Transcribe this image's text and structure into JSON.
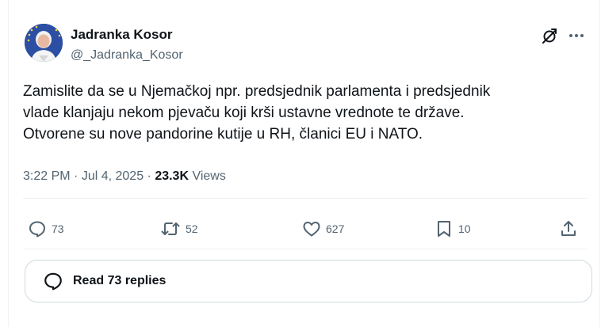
{
  "author": {
    "name": "Jadranka Kosor",
    "handle": "@_Jadranka_Kosor"
  },
  "tweet": {
    "lines": [
      "Zamislite da se u Njemačkoj npr. predsjednik parlamenta i predsjednik",
      "vlade klanjaju nekom pjevaču koji krši ustavne vrednote te države.",
      "Otvorene su nove pandorine kutije u RH, članici EU i NATO."
    ]
  },
  "meta": {
    "time": "3:22 PM",
    "separator1": " · ",
    "date": "Jul 4, 2025",
    "separator2": " · ",
    "views_count": "23.3K",
    "views_label": " Views"
  },
  "actions": {
    "replies": "73",
    "reposts": "52",
    "likes": "627",
    "bookmarks": "10"
  },
  "read_replies": {
    "label": "Read 73 replies"
  },
  "icons": {
    "header": [
      "grok-icon",
      "more-icon"
    ],
    "actions": [
      "reply-icon",
      "repost-icon",
      "like-icon",
      "bookmark-icon",
      "share-icon"
    ],
    "read_replies": "reply-bubble-icon"
  },
  "colors": {
    "text_primary": "#0f1419",
    "text_secondary": "#536471",
    "border": "#cfd9de"
  }
}
